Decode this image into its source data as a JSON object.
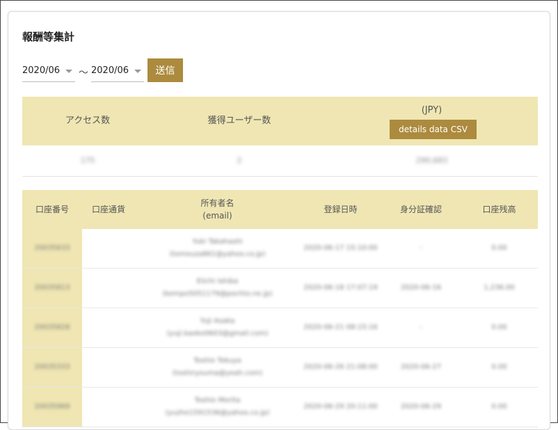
{
  "page": {
    "title": "報酬等集計"
  },
  "filter": {
    "from": "2020/06",
    "to": "2020/06",
    "separator": "～",
    "submit_label": "送信"
  },
  "summary": {
    "headers": {
      "access": "アクセス数",
      "users": "獲得ユーザー数",
      "amount": "(JPY)"
    },
    "csv_button": "details data CSV",
    "values": {
      "access": "175",
      "users": "2",
      "amount": "290,683"
    }
  },
  "accounts": {
    "headers": [
      "口座番号",
      "口座通貨",
      "所有者名",
      "(email)",
      "登録日時",
      "身分証確認",
      "口座残高"
    ],
    "rows": [
      {
        "id": "20035633",
        "currency": "",
        "name": "Yuki Takahashi",
        "email": "(tomouza861@yahoo.co.jp)",
        "registered": "2020-06-17 15:10:00",
        "verified": "-",
        "balance": "0.00"
      },
      {
        "id": "20035813",
        "currency": "",
        "name": "Eiichi Ishiba",
        "email": "(kempo5051179@pochto.ne.jp)",
        "registered": "2020-06-18 17:07:19",
        "verified": "2020-06-16",
        "balance": "1,236.00"
      },
      {
        "id": "20035828",
        "currency": "",
        "name": "Yuji Asaka",
        "email": "(yuji.kaoko0603@gmail.com)",
        "registered": "2020-06-21 08:15:16",
        "verified": "-",
        "balance": "0.00"
      },
      {
        "id": "20035333",
        "currency": "",
        "name": "Toshio Tokuya",
        "email": "(toshiryouma@yeah.com)",
        "registered": "2020-06-26 21:08:00",
        "verified": "2020-06-27",
        "balance": "0.00"
      },
      {
        "id": "20035969",
        "currency": "",
        "name": "Toshio Morita",
        "email": "(yuzhe1591536@yahoo.co.jp)",
        "registered": "2020-06-29 20:11:00",
        "verified": "2020-06-29",
        "balance": "0.00"
      }
    ]
  }
}
